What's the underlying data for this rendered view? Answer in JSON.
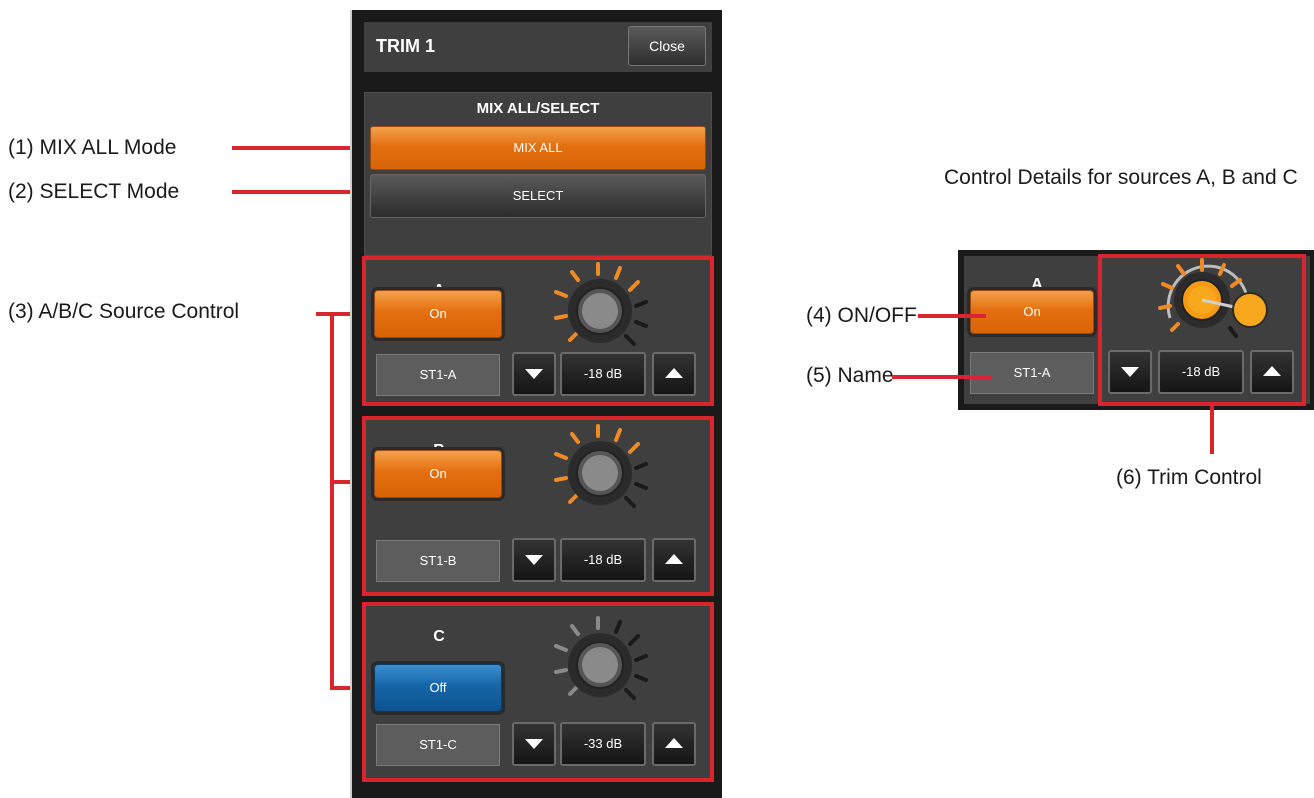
{
  "panel": {
    "title": "TRIM 1",
    "close_label": "Close",
    "mode_section_title": "MIX ALL/SELECT",
    "mix_all_label": "MIX ALL",
    "select_label": "SELECT",
    "sources": [
      {
        "letter": "A",
        "state": "On",
        "name": "ST1-A",
        "level": "-18 dB"
      },
      {
        "letter": "B",
        "state": "On",
        "name": "ST1-B",
        "level": "-18 dB"
      },
      {
        "letter": "C",
        "state": "Off",
        "name": "ST1-C",
        "level": "-33 dB"
      }
    ]
  },
  "callouts": {
    "c1": "(1) MIX ALL Mode",
    "c2": "(2) SELECT Mode",
    "c3": "(3) A/B/C Source Control",
    "c4": "(4) ON/OFF",
    "c5": "(5) Name",
    "c6": "(6) Trim Control",
    "detail_caption": "Control Details for sources A, B and C"
  },
  "detail": {
    "letter": "A",
    "state": "On",
    "name": "ST1-A",
    "level": "-18 dB"
  },
  "colors": {
    "on": "#e46f10",
    "off": "#1566a8",
    "callout_red": "#d9262e",
    "panel_bg": "#3f3f3f"
  },
  "icons": [
    "chevron-down-icon",
    "chevron-up-icon",
    "trim-knob-icon"
  ]
}
